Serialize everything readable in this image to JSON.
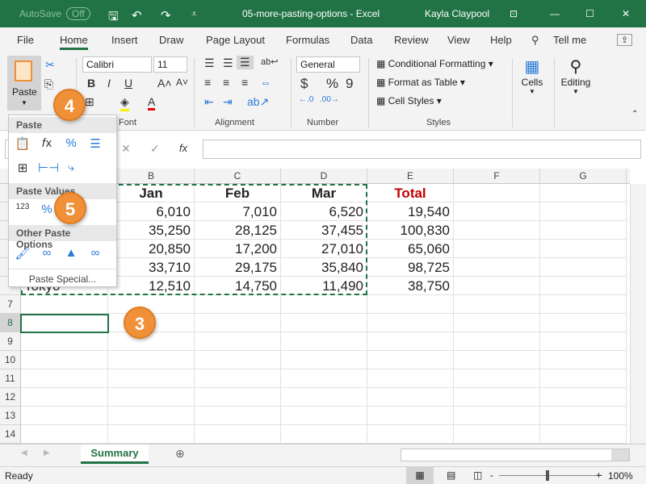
{
  "titlebar": {
    "autosave": "AutoSave",
    "toggle": "Off",
    "title": "05-more-pasting-options  -  Excel",
    "user": "Kayla Claypool"
  },
  "tabs": [
    "File",
    "Home",
    "Insert",
    "Draw",
    "Page Layout",
    "Formulas",
    "Data",
    "Review",
    "View",
    "Help",
    "Tell me"
  ],
  "ribbon": {
    "paste": "Paste",
    "font": "Calibri",
    "size": "11",
    "number_format": "General",
    "conditional": "Conditional Formatting",
    "format_table": "Format as Table",
    "cell_styles": "Cell Styles",
    "cells": "Cells",
    "editing": "Editing",
    "groups": {
      "font": "Font",
      "alignment": "Alignment",
      "number": "Number",
      "styles": "Styles"
    }
  },
  "paste_menu": {
    "paste": "Paste",
    "paste_values": "Paste Values",
    "other": "Other Paste Options",
    "special": "Paste Special..."
  },
  "formula_bar": {
    "fx": "fx"
  },
  "columns": [
    "B",
    "C",
    "D",
    "E",
    "F",
    "G"
  ],
  "rows": [
    "7",
    "8",
    "9",
    "10",
    "11",
    "12",
    "13",
    "14"
  ],
  "sheet": {
    "headers": [
      "Jan",
      "Feb",
      "Mar",
      "Total"
    ],
    "data": [
      [
        "6,010",
        "7,010",
        "6,520",
        "19,540"
      ],
      [
        "35,250",
        "28,125",
        "37,455",
        "100,830"
      ],
      [
        "20,850",
        "17,200",
        "27,010",
        "65,060"
      ],
      [
        "33,710",
        "29,175",
        "35,840",
        "98,725"
      ],
      [
        "12,510",
        "14,750",
        "11,490",
        "38,750"
      ]
    ],
    "last_label": "Tokyo",
    "total_color": "#c00000"
  },
  "callouts": [
    "3",
    "4",
    "5"
  ],
  "sheet_tab": "Summary",
  "status": {
    "ready": "Ready",
    "zoom": "100%"
  },
  "colors": {
    "accent": "#217346",
    "callout": "#f0913a"
  }
}
